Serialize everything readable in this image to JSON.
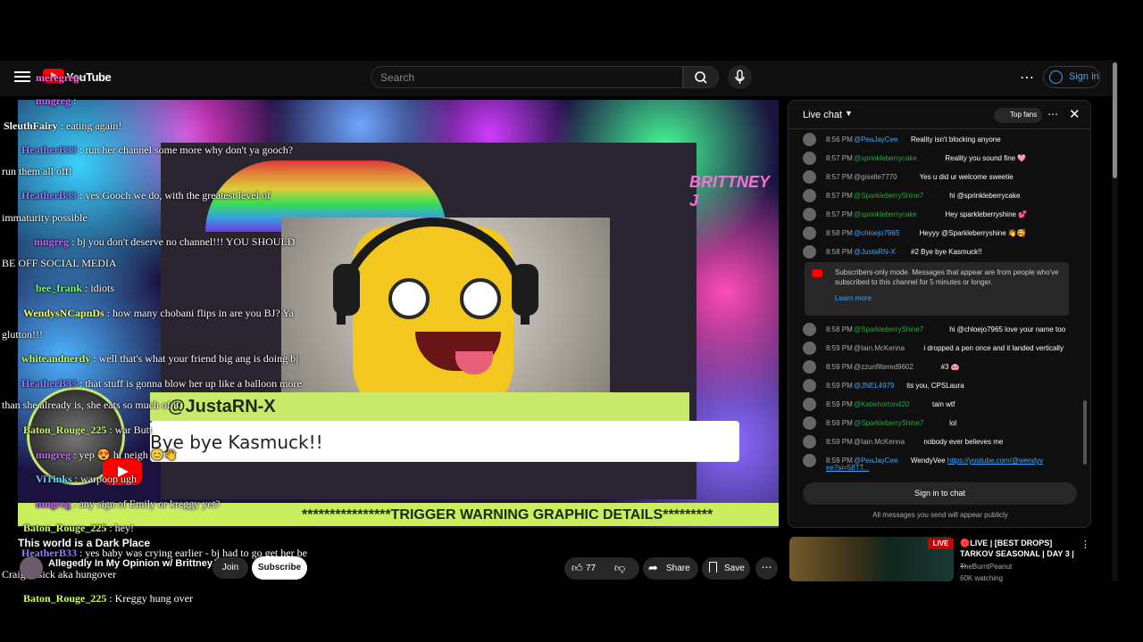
{
  "header": {
    "logo_text": "YouTube",
    "search_placeholder": "Search",
    "signin_label": "Sign in"
  },
  "video": {
    "brand_overlay": "BRITTNEY J",
    "handle": "@JustaRN-X",
    "message": "Bye bye Kasmuck!!",
    "warning": "****************TRIGGER WARNING GRAPHIC DETAILS*********",
    "title": "This world is a Dark Place",
    "channel": "Allegedly In My Opinion w/ BrittneyJ",
    "join_label": "Join",
    "subscribe_label": "Subscribe",
    "like_count": "77",
    "share_label": "Share",
    "save_label": "Save"
  },
  "overlay_chat": [
    {
      "name": "meregreg",
      "msg": ":"
    },
    {
      "name": "mngreg",
      "msg": ":"
    },
    {
      "name": "SleuthFairy",
      "msg": ": eating again!"
    },
    {
      "name": "HeatherB33",
      "msg": ": run her channel some more why don't ya gooch?"
    },
    {
      "name": "",
      "msg": "run them all off!"
    },
    {
      "name": "HeatherB33",
      "msg": ": yes Gooch we do, with the greatest level of"
    },
    {
      "name": "",
      "msg": "immaturity possible"
    },
    {
      "name": "mngreg",
      "msg": ": bj you don't deserve no channel!!! YOU SHOULD"
    },
    {
      "name": "",
      "msg": "BE OFF SOCIAL MEDIA"
    },
    {
      "name": "bee_frank",
      "msg": ": idiots"
    },
    {
      "name": "WendysNCapnDs",
      "msg": ": how many chobani flips in are you BJ? Ya"
    },
    {
      "name": "",
      "msg": "glutton!!!"
    },
    {
      "name": "whiteandnerdy",
      "msg": ": well that's what your friend big ang is doing bj"
    },
    {
      "name": "HeatherB33",
      "msg": ": that stuff is gonna blow her up like a balloon more"
    },
    {
      "name": "",
      "msg": "than she already is, she eats so much of it"
    },
    {
      "name": "Baton_Rouge_225",
      "msg": ": war Butt"
    },
    {
      "name": "mngreg",
      "msg": ": yep 😍 hi neigh 😊👋"
    },
    {
      "name": "ViTinks",
      "msg": ": warpoop ugh"
    },
    {
      "name": "mngreg",
      "msg": ": any sign of Emily or kreggy yet?"
    },
    {
      "name": "Baton_Rouge_225",
      "msg": ": hey!"
    },
    {
      "name": "HeatherB33",
      "msg": ": yes baby was crying earlier - bj had to go get her be"
    },
    {
      "name": "",
      "msg": "Craig is sick aka hungover"
    },
    {
      "name": "Baton_Rouge_225",
      "msg": ": Kreggy hung over"
    }
  ],
  "chat": {
    "title": "Live chat",
    "top_fans_label": "Top fans",
    "messages": [
      {
        "time": "8:56 PM",
        "user": "@PeaJayCee",
        "msg": "Reality isn't blocking anyone",
        "color": "blue"
      },
      {
        "time": "8:57 PM",
        "user": "@sprinkleberrycake",
        "msg": "Reality you sound fine 🩷",
        "color": "green"
      },
      {
        "time": "8:57 PM",
        "user": "@giselle7770",
        "msg": "Yes u did ur welcome sweetie",
        "color": "gray"
      },
      {
        "time": "8:57 PM",
        "user": "@SparkleberryShine7",
        "msg": "hi @sprinkleberrycake",
        "color": "green"
      },
      {
        "time": "8:57 PM",
        "user": "@sprinkleberrycake",
        "msg": "Hey sparkleberryshine 💕",
        "color": "green"
      },
      {
        "time": "8:58 PM",
        "user": "@chloejo7965",
        "msg": "Heyyy @Sparkleberryshine 👋🥰",
        "color": "blue"
      },
      {
        "time": "8:58 PM",
        "user": "@JustaRN-X",
        "msg": "#2   Bye bye Kasmuck!!",
        "color": "blue"
      },
      {
        "time": "8:58 PM",
        "user": "@SparkleberryShine7",
        "msg": "hi @chloejo7965 love your name too",
        "color": "green"
      },
      {
        "time": "8:59 PM",
        "user": "@Iain.McKenna",
        "msg": "i dropped a pen once and it landed vertically",
        "color": "gray"
      },
      {
        "time": "8:59 PM",
        "user": "@zzunfiltered9602",
        "msg": "#3 🐽",
        "color": "gray"
      },
      {
        "time": "8:59 PM",
        "user": "@JNEL4979",
        "msg": "its you, CPSLaura",
        "color": "blue"
      },
      {
        "time": "8:59 PM",
        "user": "@Katiehorton420",
        "msg": "tain wtf",
        "color": "green"
      },
      {
        "time": "8:59 PM",
        "user": "@SparkleberryShine7",
        "msg": "lol",
        "color": "green"
      },
      {
        "time": "8:59 PM",
        "user": "@Iain.McKenna",
        "msg": "nobody ever believes me",
        "color": "gray"
      },
      {
        "time": "8:59 PM",
        "user": "@PeaJayCee",
        "msg": "WendyVee",
        "link": "https://youtube.com/@wendyv",
        "color": "blue"
      }
    ],
    "link_cont": "ee?si=58TT...",
    "submode_text": "Subscribers-only mode. Messages that appear are from people who've subscribed to this channel for 5 minutes or longer.",
    "learn_more": "Learn more",
    "signin_label": "Sign in to chat",
    "public_note": "All messages you send will appear publicly"
  },
  "recommendation": {
    "live_label": "LIVE",
    "title": "🔴LIVE | [BEST DROPS] TARKOV SEASONAL | DAY 3 | ...",
    "channel": "TheBurntPeanut",
    "views": "60K watching"
  }
}
